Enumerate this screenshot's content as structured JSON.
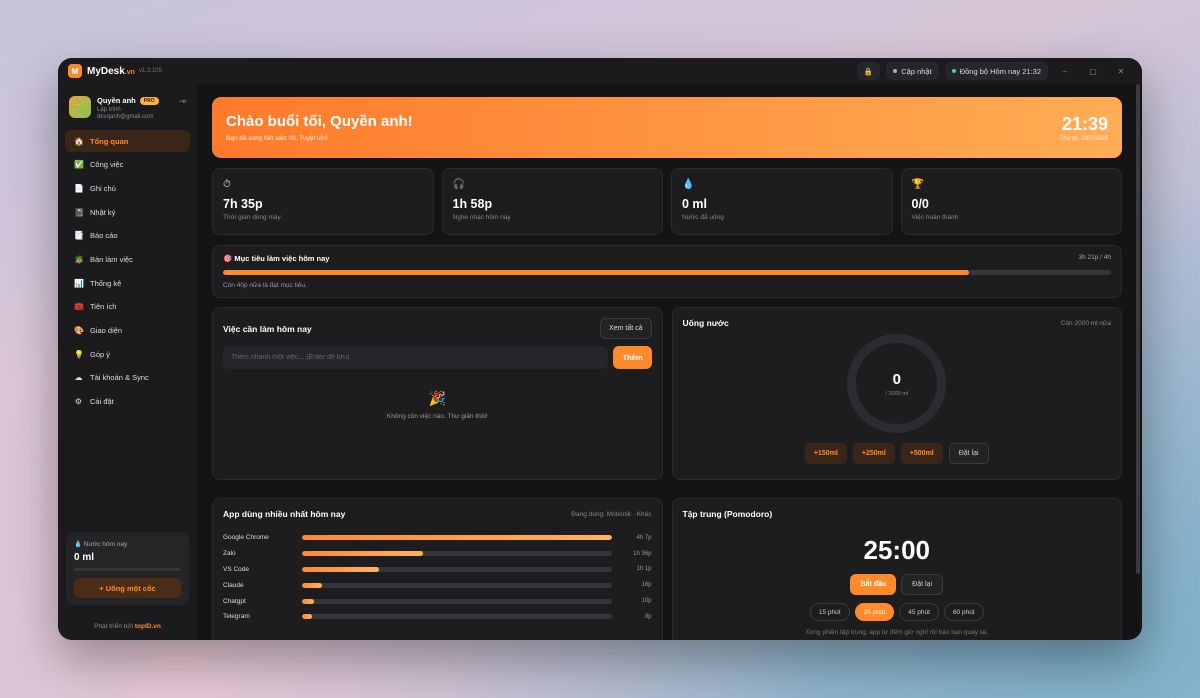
{
  "titlebar": {
    "logo": "M",
    "brand": "MyDesk",
    "tld": ".vn",
    "version": "v1.3.105",
    "lock_icon": "lock-icon",
    "update_label": "Cập nhật",
    "sync_label": "Đồng bộ Hôm nay 21:32",
    "minimize": "–",
    "maximize": "▢",
    "close": "✕"
  },
  "profile": {
    "name": "Quyền anh",
    "badge": "PRO",
    "role": "Lập trình",
    "email": "devqanh@gmail.com"
  },
  "nav": [
    {
      "label": "Tổng quan",
      "icon": "🏠"
    },
    {
      "label": "Công việc",
      "icon": "✅"
    },
    {
      "label": "Ghi chú",
      "icon": "📄"
    },
    {
      "label": "Nhật ký",
      "icon": "📓"
    },
    {
      "label": "Báo cáo",
      "icon": "📑"
    },
    {
      "label": "Bàn làm việc",
      "icon": "🪴"
    },
    {
      "label": "Thống kê",
      "icon": "📊"
    },
    {
      "label": "Tiện ích",
      "icon": "🧰"
    },
    {
      "label": "Giao diện",
      "icon": "🎨"
    },
    {
      "label": "Góp ý",
      "icon": "💡"
    },
    {
      "label": "Tài khoản & Sync",
      "icon": "☁"
    },
    {
      "label": "Cài đặt",
      "icon": "⚙"
    }
  ],
  "sidebar_water": {
    "title": "Nước hôm nay",
    "value": "0 ml",
    "button": "+ Uống một cốc"
  },
  "dev": {
    "prefix": "Phát triển bởi",
    "name": "topID.vn"
  },
  "hero": {
    "greeting": "Chào buổi tối, Quyền anh!",
    "sub": "Bạn đã xong hết việc rồi. Tuyệt vời!",
    "time": "21:39",
    "date": "Thứ tư, 29/7/2026"
  },
  "stats": [
    {
      "icon": "⏱",
      "value": "7h 35p",
      "label": "Thời gian dùng máy"
    },
    {
      "icon": "🎧",
      "value": "1h 58p",
      "label": "Nghe nhạc hôm nay"
    },
    {
      "icon": "💧",
      "value": "0 ml",
      "label": "Nước đã uống"
    },
    {
      "icon": "🏆",
      "value": "0/0",
      "label": "Việc hoàn thành"
    }
  ],
  "goal": {
    "title": "🎯 Mục tiêu làm việc hôm nay",
    "value": "3h 21p / 4h",
    "progress": 0.84,
    "note": "Còn 40p nữa là đạt mục tiêu."
  },
  "todo": {
    "title": "Việc cần làm hôm nay",
    "view_all": "Xem tất cả",
    "placeholder": "Thêm nhanh một việc... (Enter để lưu)",
    "add": "Thêm",
    "empty_icon": "🎉",
    "empty_text": "Không còn việc nào. Thư giãn thôi!"
  },
  "water": {
    "title": "Uống nước",
    "remaining": "Còn 2000 ml nữa",
    "value": "0",
    "target": "/ 2000 ml",
    "buttons": [
      "+150ml",
      "+250ml",
      "+500ml"
    ],
    "reset": "Đặt lại"
  },
  "apps": {
    "title": "App dùng nhiều nhất hôm nay",
    "current": "Đang dùng: Motionik · Khác",
    "items": [
      {
        "name": "Google Chrome",
        "time": "4h 7p",
        "fraction": 1.0
      },
      {
        "name": "Zalo",
        "time": "1h 36p",
        "fraction": 0.39
      },
      {
        "name": "VS Code",
        "time": "1h 1p",
        "fraction": 0.25
      },
      {
        "name": "Claude",
        "time": "16p",
        "fraction": 0.065
      },
      {
        "name": "Chatgpt",
        "time": "10p",
        "fraction": 0.04
      },
      {
        "name": "Telegram",
        "time": "8p",
        "fraction": 0.032
      }
    ]
  },
  "pomodoro": {
    "title": "Tập trung (Pomodoro)",
    "time": "25:00",
    "start": "Bắt đầu",
    "reset": "Đặt lại",
    "durations": [
      "15 phút",
      "25 phút",
      "45 phút",
      "60 phút"
    ],
    "active_duration": "25 phút",
    "note": "Xong phiên tập trung, app tự đếm giờ nghỉ rồi báo bạn quay lại."
  },
  "colors": {
    "accent": "#ff8a2b",
    "bg": "#141416",
    "panel": "#1d1d20"
  }
}
